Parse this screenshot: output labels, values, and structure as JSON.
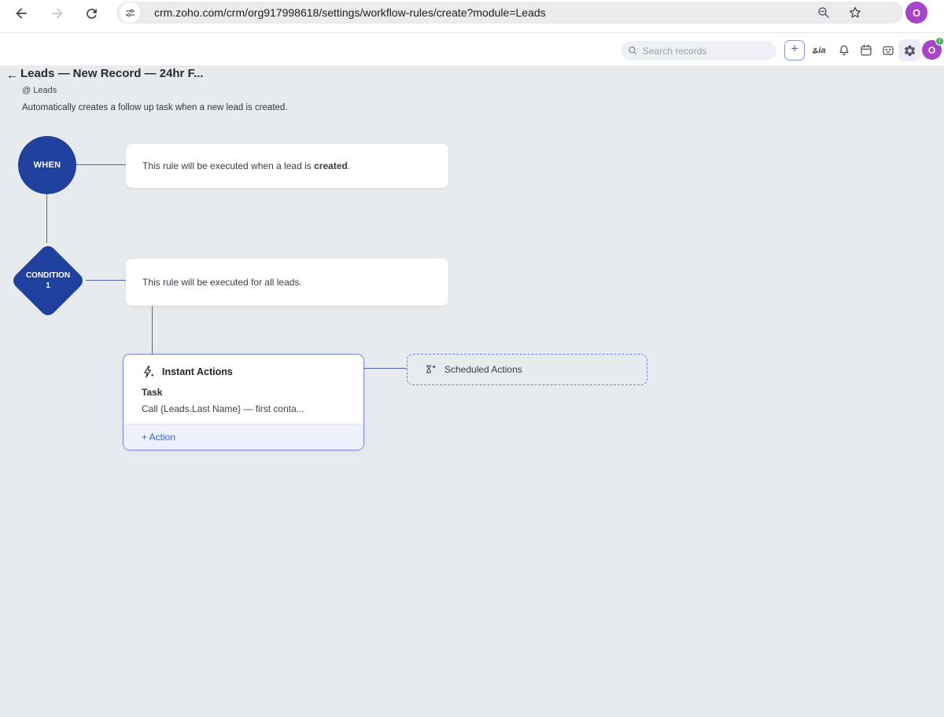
{
  "browser": {
    "url": "crm.zoho.com/crm/org917998618/settings/workflow-rules/create?module=Leads",
    "profile_initial": "O"
  },
  "header": {
    "search_placeholder": "Search records",
    "add_button": "+",
    "profile_initial": "O",
    "notification_badge": "!"
  },
  "page": {
    "back": "←",
    "title": "Leads — New Record — 24hr F...",
    "module": "@ Leads",
    "description": "Automatically creates a follow up task when a new lead is created."
  },
  "flow": {
    "when_label": "WHEN",
    "when_text_prefix": "This rule will be executed when a lead is ",
    "when_text_bold": "created",
    "when_text_suffix": ".",
    "condition_label_1": "CONDITION",
    "condition_label_2": "1",
    "condition_text": "This rule will be executed for all leads.",
    "instant_title": "Instant Actions",
    "instant_item_type": "Task",
    "instant_item_text": "Call {Leads.Last Name} — first conta...",
    "instant_add_action": "+ Action",
    "scheduled_title": "Scheduled Actions"
  },
  "colors": {
    "node_blue": "#1f419d",
    "connector_blue": "#4c64ad",
    "accent_blue": "#3465dc",
    "instant_border": "#7b83e4",
    "scheduled_border": "#6b84d8",
    "avatar_purple": "#a844c8",
    "badge_green": "#35b558",
    "canvas_bg": "#e8ebee"
  }
}
